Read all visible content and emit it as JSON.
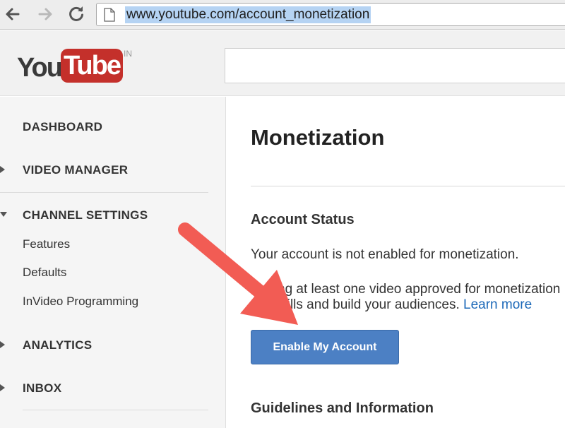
{
  "browser": {
    "url": "www.youtube.com/account_monetization",
    "icons": [
      "back-arrow-icon",
      "forward-arrow-icon",
      "reload-icon",
      "page-icon"
    ]
  },
  "header": {
    "logo_you": "You",
    "logo_tube": "Tube",
    "logo_country": "IN",
    "search_value": ""
  },
  "sidebar": {
    "dashboard": "DASHBOARD",
    "video_manager": "VIDEO MANAGER",
    "channel_settings": "CHANNEL SETTINGS",
    "channel_items": [
      "Features",
      "Defaults",
      "InVideo Programming"
    ],
    "analytics": "ANALYTICS",
    "inbox": "INBOX"
  },
  "main": {
    "title": "Monetization",
    "account_status_heading": "Account Status",
    "status_text": "Your account is not enabled for monetization.",
    "info_line1": "Having at least one video approved for monetization",
    "info_line2": "our skills and build your audiences.",
    "learn_more": "Learn more",
    "enable_button": "Enable My Account",
    "guidelines_heading": "Guidelines and Information"
  },
  "colors": {
    "arrow": "#f25c54",
    "button": "#4c80c4",
    "logo_red": "#c4302b",
    "link": "#1b68b8"
  }
}
